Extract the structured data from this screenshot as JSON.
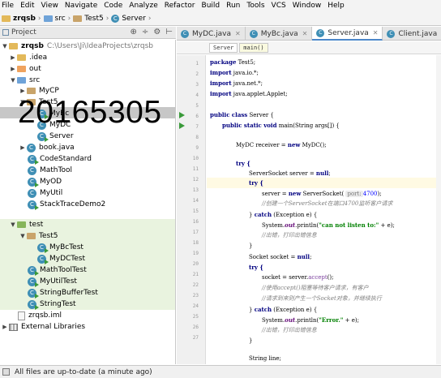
{
  "menu": [
    "File",
    "Edit",
    "View",
    "Navigate",
    "Code",
    "Analyze",
    "Refactor",
    "Build",
    "Run",
    "Tools",
    "VCS",
    "Window",
    "Help"
  ],
  "breadcrumb": {
    "project": "zrqsb",
    "folder1": "src",
    "folder2": "Test5",
    "file": "Server"
  },
  "project_panel": {
    "title": "Project",
    "tools": [
      "⊕",
      "÷",
      "⚙",
      "⊢"
    ]
  },
  "tree": {
    "root_name": "zrqsb",
    "root_path": "C:\\Users\\Ji\\IdeaProjects\\zrqsb",
    "idea": ".idea",
    "out": "out",
    "src": "src",
    "mycp": "MyCP",
    "test5": "Test5",
    "test5_class_a": "MyBc",
    "test5_class_b": "MyDC",
    "test5_class_c": "Server",
    "book": "book.java",
    "codestandard": "CodeStandard",
    "mathtool": "MathTool",
    "myod": "MyOD",
    "myutil": "MyUtil",
    "stacktrace": "StackTraceDemo2",
    "test": "test",
    "test_test5": "Test5",
    "mybctest": "MyBcTest",
    "mydctest": "MyDCTest",
    "mathtooltest": "MathToolTest",
    "myutiltest": "MyUtilTest",
    "stringbuffertest": "StringBufferTest",
    "stringtest": "StringTest",
    "iml": "zrqsb.iml",
    "libs": "External Libraries"
  },
  "overlay_number": "20165305",
  "tabs": [
    {
      "label": "MyDC.java"
    },
    {
      "label": "MyBc.java"
    },
    {
      "label": "Server.java"
    },
    {
      "label": "Client.java"
    }
  ],
  "subnav": {
    "a": "Server",
    "b": "main()"
  },
  "code": {
    "l1_kw": "package",
    "l1_rest": " Test5;",
    "l2_kw": "import",
    "l2_rest": " java.io.*;",
    "l3_kw": "import",
    "l3_rest": " java.net.*;",
    "l4_kw": "import",
    "l4_rest": " java.applet.Applet;",
    "l5_kw": "public class",
    "l5_rest": " Server {",
    "l6_kw": "public static void",
    "l6_rest": " main(String args[]) {",
    "l7_a": "MyDC receiver = ",
    "l7_kw": "new",
    "l7_b": " MyDC();",
    "l8": "try {",
    "l9_a": "ServerSocket server = ",
    "l9_kw": "null",
    "l9_b": ";",
    "l10": "try {",
    "l11_a": "server = ",
    "l11_kw": "new",
    "l11_b": " ServerSocket( ",
    "l11_hint": "port:",
    "l11_num": "4700",
    "l11_c": ");",
    "l12": "//创建一个ServerSocket在端口4700监听客户请求",
    "l13_a": "} ",
    "l13_kw": "catch",
    "l13_b": " (Exception e) {",
    "l14_a": "System.",
    "l14_fld": "out",
    "l14_b": ".println(",
    "l14_str": "\"can not listen to:\"",
    "l14_c": " + e);",
    "l15": "//出错，打印出错信息",
    "l16": "}",
    "l17_a": "Socket socket = ",
    "l17_kw": "null",
    "l17_b": ";",
    "l18": "try {",
    "l19_a": "socket = server.",
    "l19_m": "accept",
    "l19_b": "();",
    "l20": "//使用accept()阻塞等待客户请求，有客户",
    "l21": "//请求到来则产生一个Socket对象，并继续执行",
    "l22_a": "} ",
    "l22_kw": "catch",
    "l22_b": " (Exception e) {",
    "l23_a": "System.",
    "l23_fld": "out",
    "l23_b": ".println(",
    "l23_str": "\"Error.\"",
    "l23_c": " + e);",
    "l24": "//出错，打印出错信息",
    "l25": "}",
    "l26": "String line;"
  },
  "status": {
    "text": "All files are up-to-date (a minute ago)"
  },
  "colors": {
    "selection": "#c7c7c7",
    "test_highlight": "#e9f3df",
    "keyword": "#000080",
    "string": "#008000",
    "comment": "#808080"
  }
}
